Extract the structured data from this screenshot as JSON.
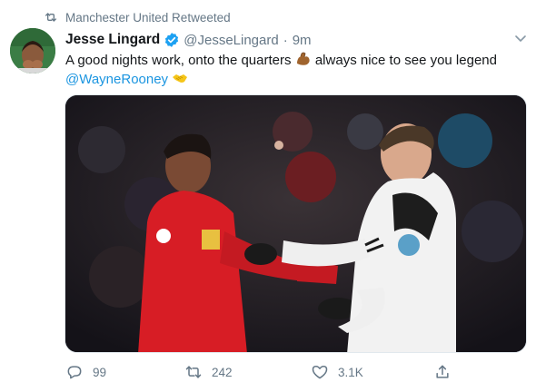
{
  "colors": {
    "secondary_text": "#657786",
    "link": "#1b95e0",
    "verified": "#1da1f2",
    "primary_text": "#14171a"
  },
  "retweet_context": {
    "icon": "retweet-icon",
    "text": "Manchester United Retweeted"
  },
  "tweet": {
    "author_name": "Jesse Lingard",
    "handle": "@JesseLingard",
    "separator": "·",
    "time": "9m",
    "verified_icon": "verified-badge-icon",
    "text_part1": "A good nights work, onto the quarters",
    "text_part2": "always nice to see you legend",
    "mention": "@WayneRooney",
    "emoji_1": "flexed-biceps-emoji",
    "emoji_2": "handshake-emoji",
    "media_alt": "photo"
  },
  "actions": {
    "reply_count": "99",
    "retweet_count": "242",
    "like_count": "3.1K",
    "reply_icon": "reply-icon",
    "retweet_icon": "retweet-icon",
    "like_icon": "heart-icon",
    "share_icon": "share-icon"
  }
}
